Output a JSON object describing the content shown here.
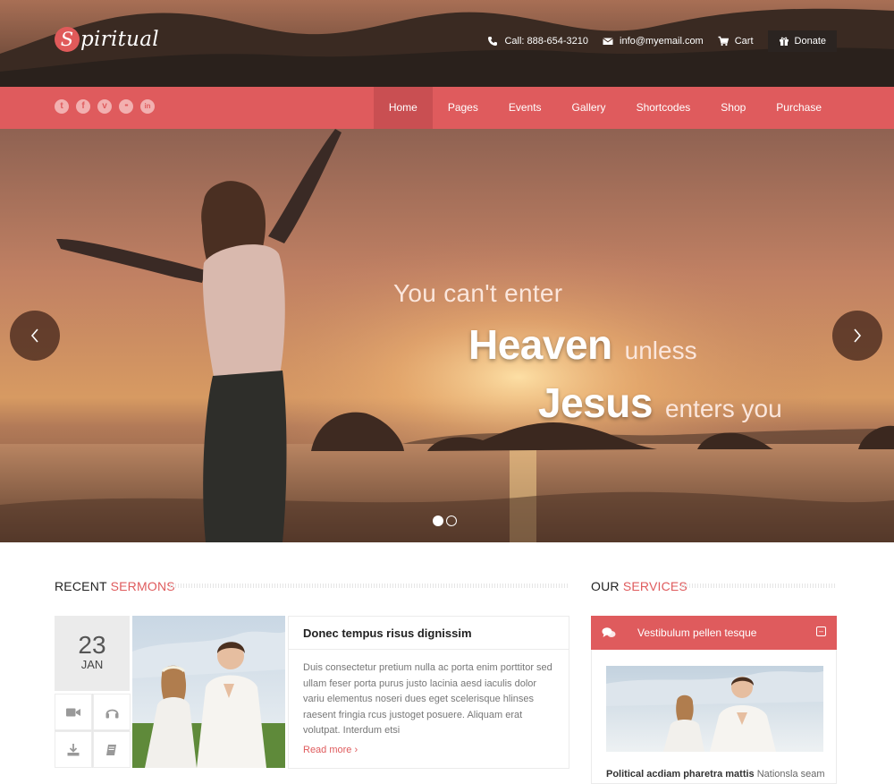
{
  "header": {
    "logo_letter": "S",
    "logo_text": "piritual",
    "phone": "Call: 888-654-3210",
    "email": "info@myemail.com",
    "cart": "Cart",
    "donate": "Donate"
  },
  "social": [
    {
      "icon": "twitter-icon",
      "glyph": "t"
    },
    {
      "icon": "facebook-icon",
      "glyph": "f"
    },
    {
      "icon": "vimeo-icon",
      "glyph": "v"
    },
    {
      "icon": "flickr-icon",
      "glyph": "••"
    },
    {
      "icon": "linkedin-icon",
      "glyph": "in"
    }
  ],
  "nav": {
    "items": [
      {
        "label": "Home",
        "active": true
      },
      {
        "label": "Pages",
        "active": false
      },
      {
        "label": "Events",
        "active": false
      },
      {
        "label": "Gallery",
        "active": false
      },
      {
        "label": "Shortcodes",
        "active": false
      },
      {
        "label": "Shop",
        "active": false
      },
      {
        "label": "Purchase",
        "active": false
      }
    ]
  },
  "hero": {
    "line1": "You can't enter",
    "line2_big": "Heaven",
    "line2_small": "unless",
    "line3_big": "Jesus",
    "line3_small": "enters you",
    "prev": "‹",
    "next": "›",
    "slides": 2,
    "active_slide": 1
  },
  "sermons": {
    "title_plain": "RECENT",
    "title_accent": "SERMONS",
    "day": "23",
    "month": "JAN",
    "media_icons": [
      "video-icon",
      "audio-icon",
      "download-icon",
      "book-icon"
    ],
    "post_title": "Donec tempus risus dignissim",
    "post_body": "Duis consectetur pretium nulla ac porta enim porttitor sed ullam feser porta purus justo lacinia aesd iaculis dolor variu elementus noseri dues eget scelerisque hlinses raesent fringia rcus justoget posuere. Aliquam erat volutpat. Interdum etsi",
    "read_more": "Read more ›"
  },
  "services": {
    "title_plain": "OUR",
    "title_accent": "SERVICES",
    "panel_title": "Vestibulum pellen tesque",
    "text_bold": "Political acdiam pharetra mattis",
    "text_rest": " Nationsla seam"
  },
  "colors": {
    "accent": "#df5b5d",
    "accent_dark": "#c94f52",
    "donate_bg": "#2b2421"
  }
}
